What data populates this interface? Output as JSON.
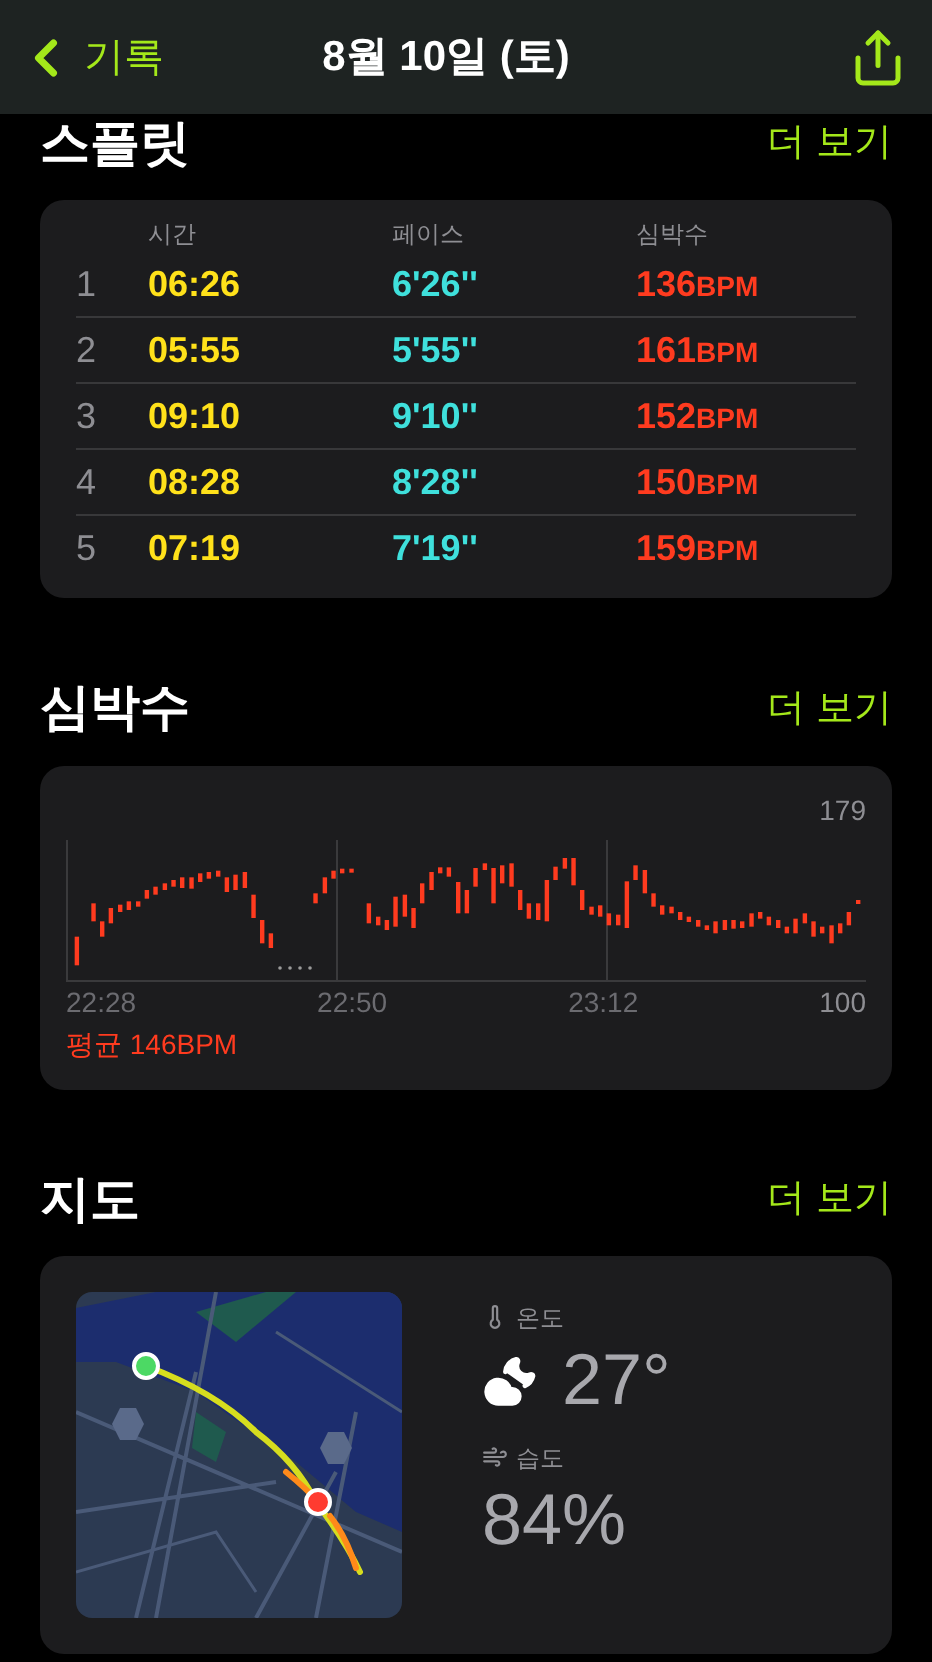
{
  "nav": {
    "back": "기록",
    "title": "8월 10일 (토)"
  },
  "splits": {
    "title": "스플릿",
    "more": "더 보기",
    "columns": [
      "시간",
      "페이스",
      "심박수"
    ],
    "rows": [
      {
        "index": "1",
        "time": "06:26",
        "pace": "6'26''",
        "bpm": "136",
        "unit": "BPM"
      },
      {
        "index": "2",
        "time": "05:55",
        "pace": "5'55''",
        "bpm": "161",
        "unit": "BPM"
      },
      {
        "index": "3",
        "time": "09:10",
        "pace": "9'10''",
        "bpm": "152",
        "unit": "BPM"
      },
      {
        "index": "4",
        "time": "08:28",
        "pace": "8'28''",
        "bpm": "150",
        "unit": "BPM"
      },
      {
        "index": "5",
        "time": "07:19",
        "pace": "7'19''",
        "bpm": "159",
        "unit": "BPM"
      }
    ]
  },
  "heart_rate": {
    "title": "심박수",
    "more": "더 보기",
    "y_max": "179",
    "y_min": "100",
    "x_labels": [
      "22:28",
      "22:50",
      "23:12"
    ],
    "average": "평균 146BPM"
  },
  "map": {
    "title": "지도",
    "more": "더 보기",
    "temperature_label": "온도",
    "temperature": "27°",
    "humidity_label": "습도",
    "humidity": "84%"
  }
}
